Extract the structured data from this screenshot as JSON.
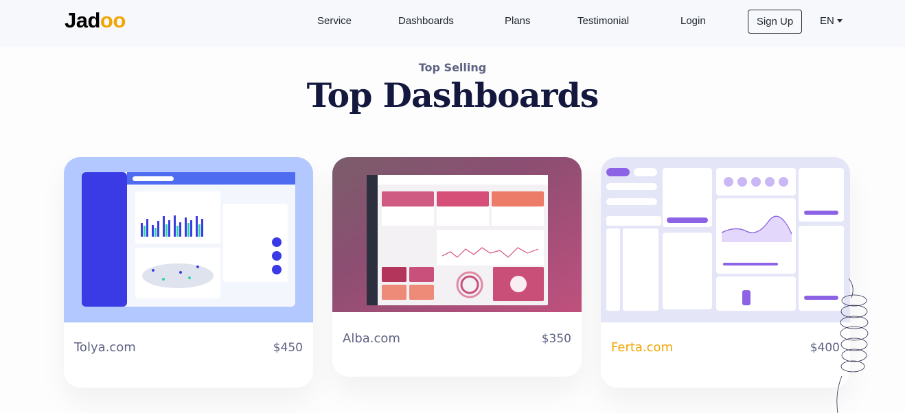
{
  "nav": {
    "logo": "Jadoo",
    "links": [
      "Service",
      "Dashboards",
      "Plans",
      "Testimonial",
      "Login"
    ],
    "signup": "Sign Up",
    "lang": "EN"
  },
  "section": {
    "eyebrow": "Top Selling",
    "title": "Top Dashboards"
  },
  "cards": [
    {
      "name": "Tolya.com",
      "price": "$450"
    },
    {
      "name": "Alba.com",
      "price": "$350"
    },
    {
      "name": "Ferta.com",
      "price": "$400"
    }
  ],
  "colors": {
    "accent": "#f1a501",
    "heading": "#14183e",
    "text": "#5e6282"
  },
  "icons": [
    "caret-down-icon"
  ]
}
